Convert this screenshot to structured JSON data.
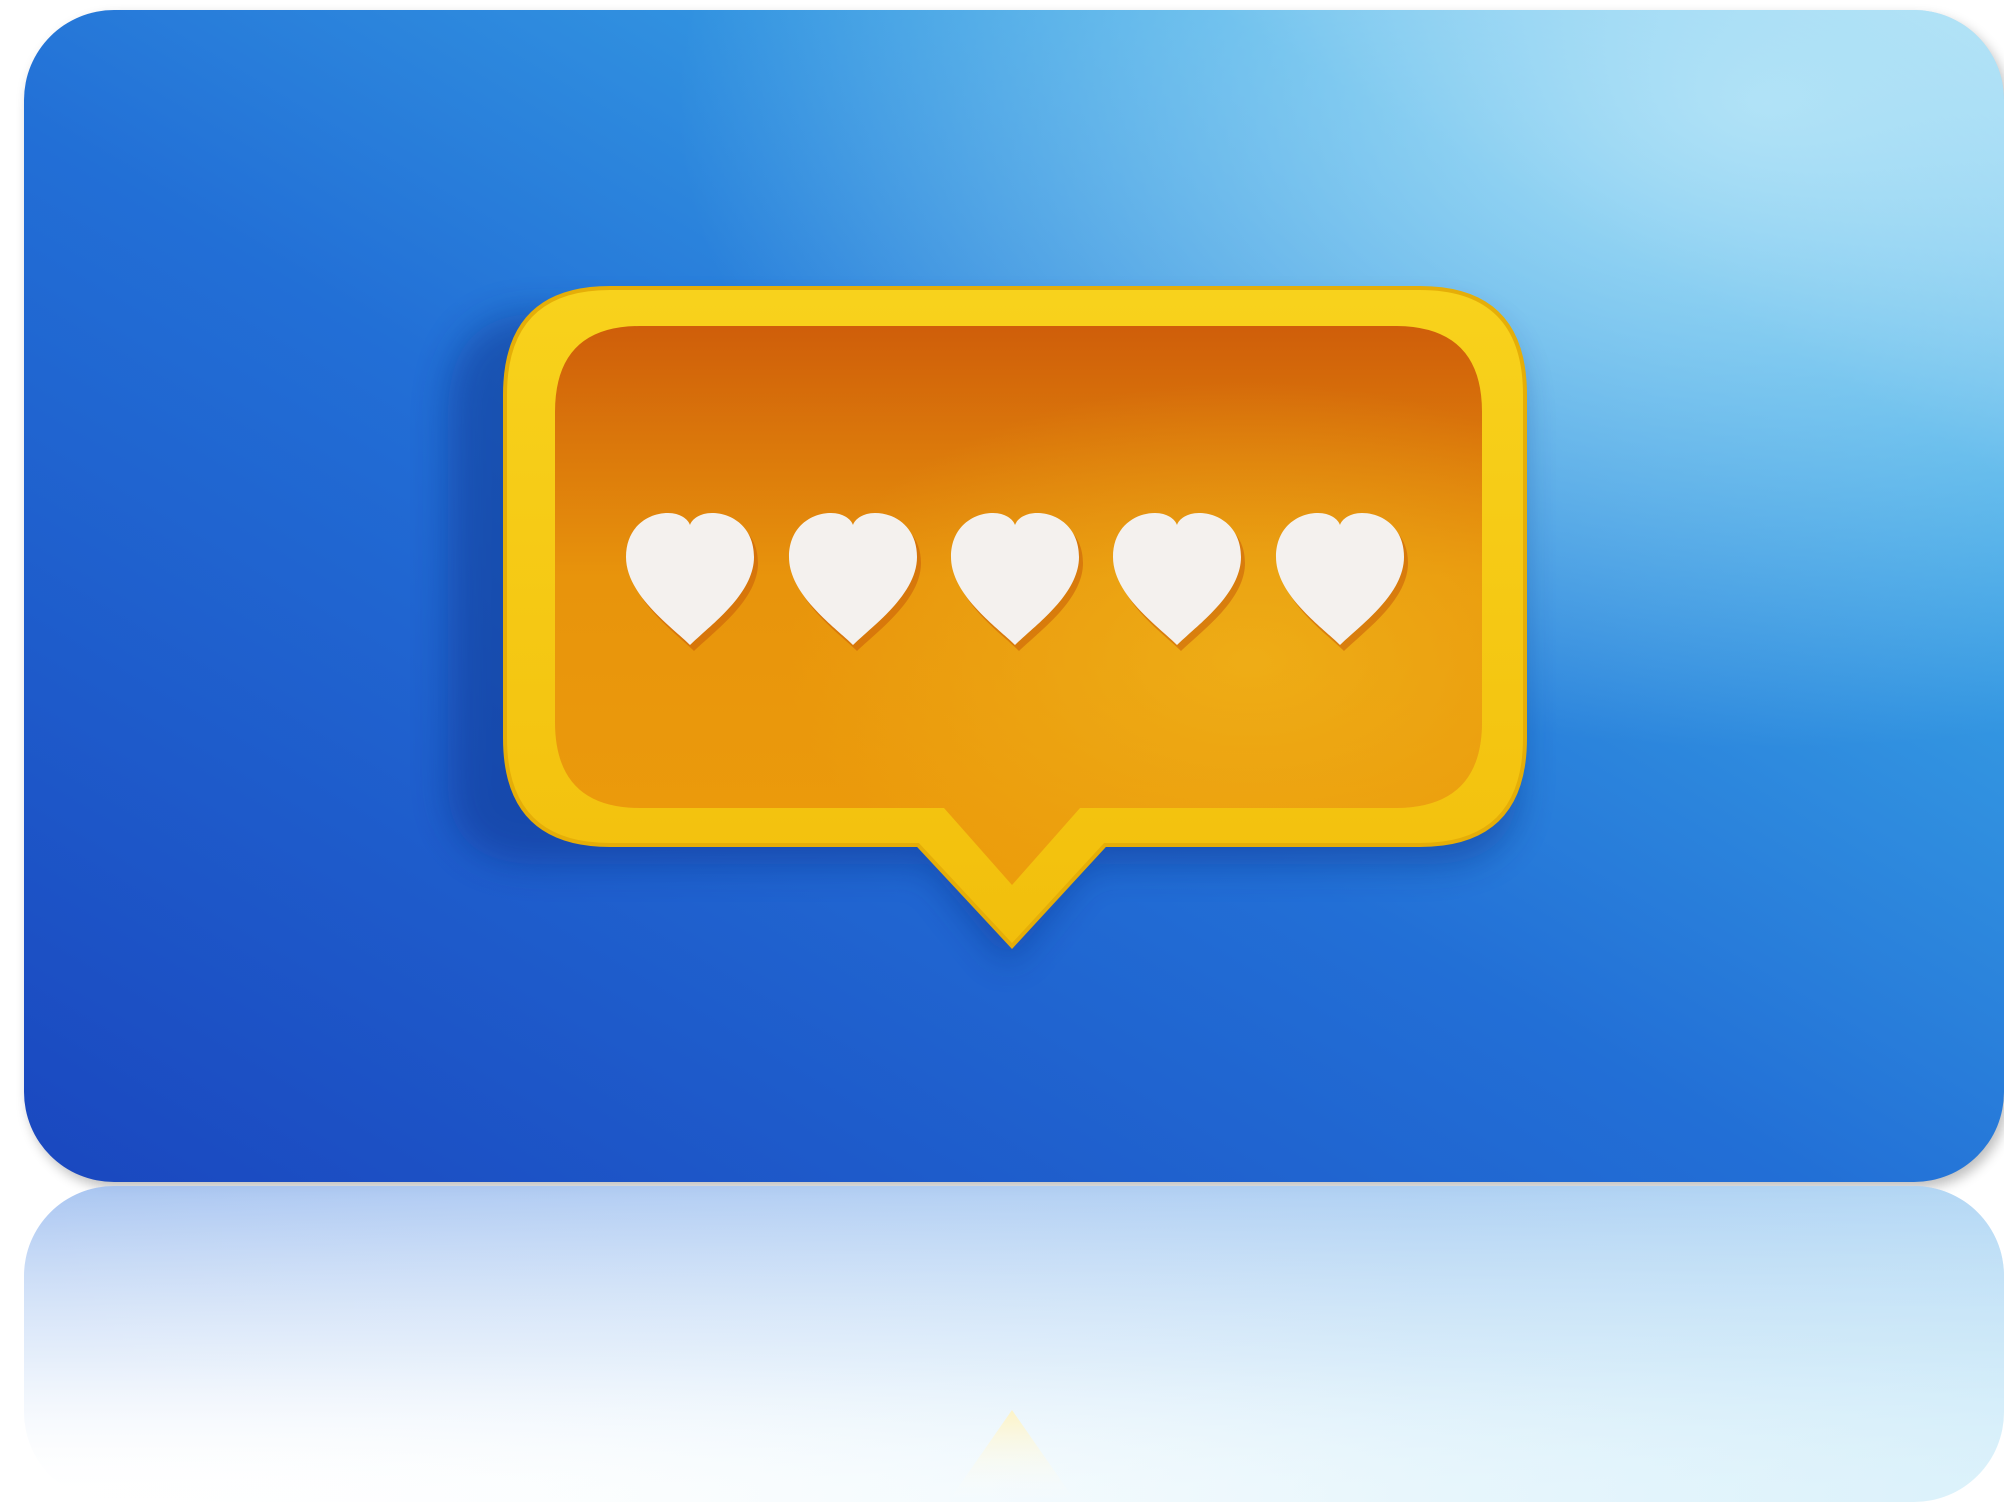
{
  "image": {
    "subject": "speech-bubble-with-hearts",
    "heart_count": 5,
    "colors": {
      "background_deep_blue": "#1b4fc4",
      "background_light_blue": "#8fd3f1",
      "bubble_frame_yellow": "#f6c814",
      "bubble_inner_orange": "#e98b0b",
      "heart_white": "#f4f1ee"
    }
  }
}
